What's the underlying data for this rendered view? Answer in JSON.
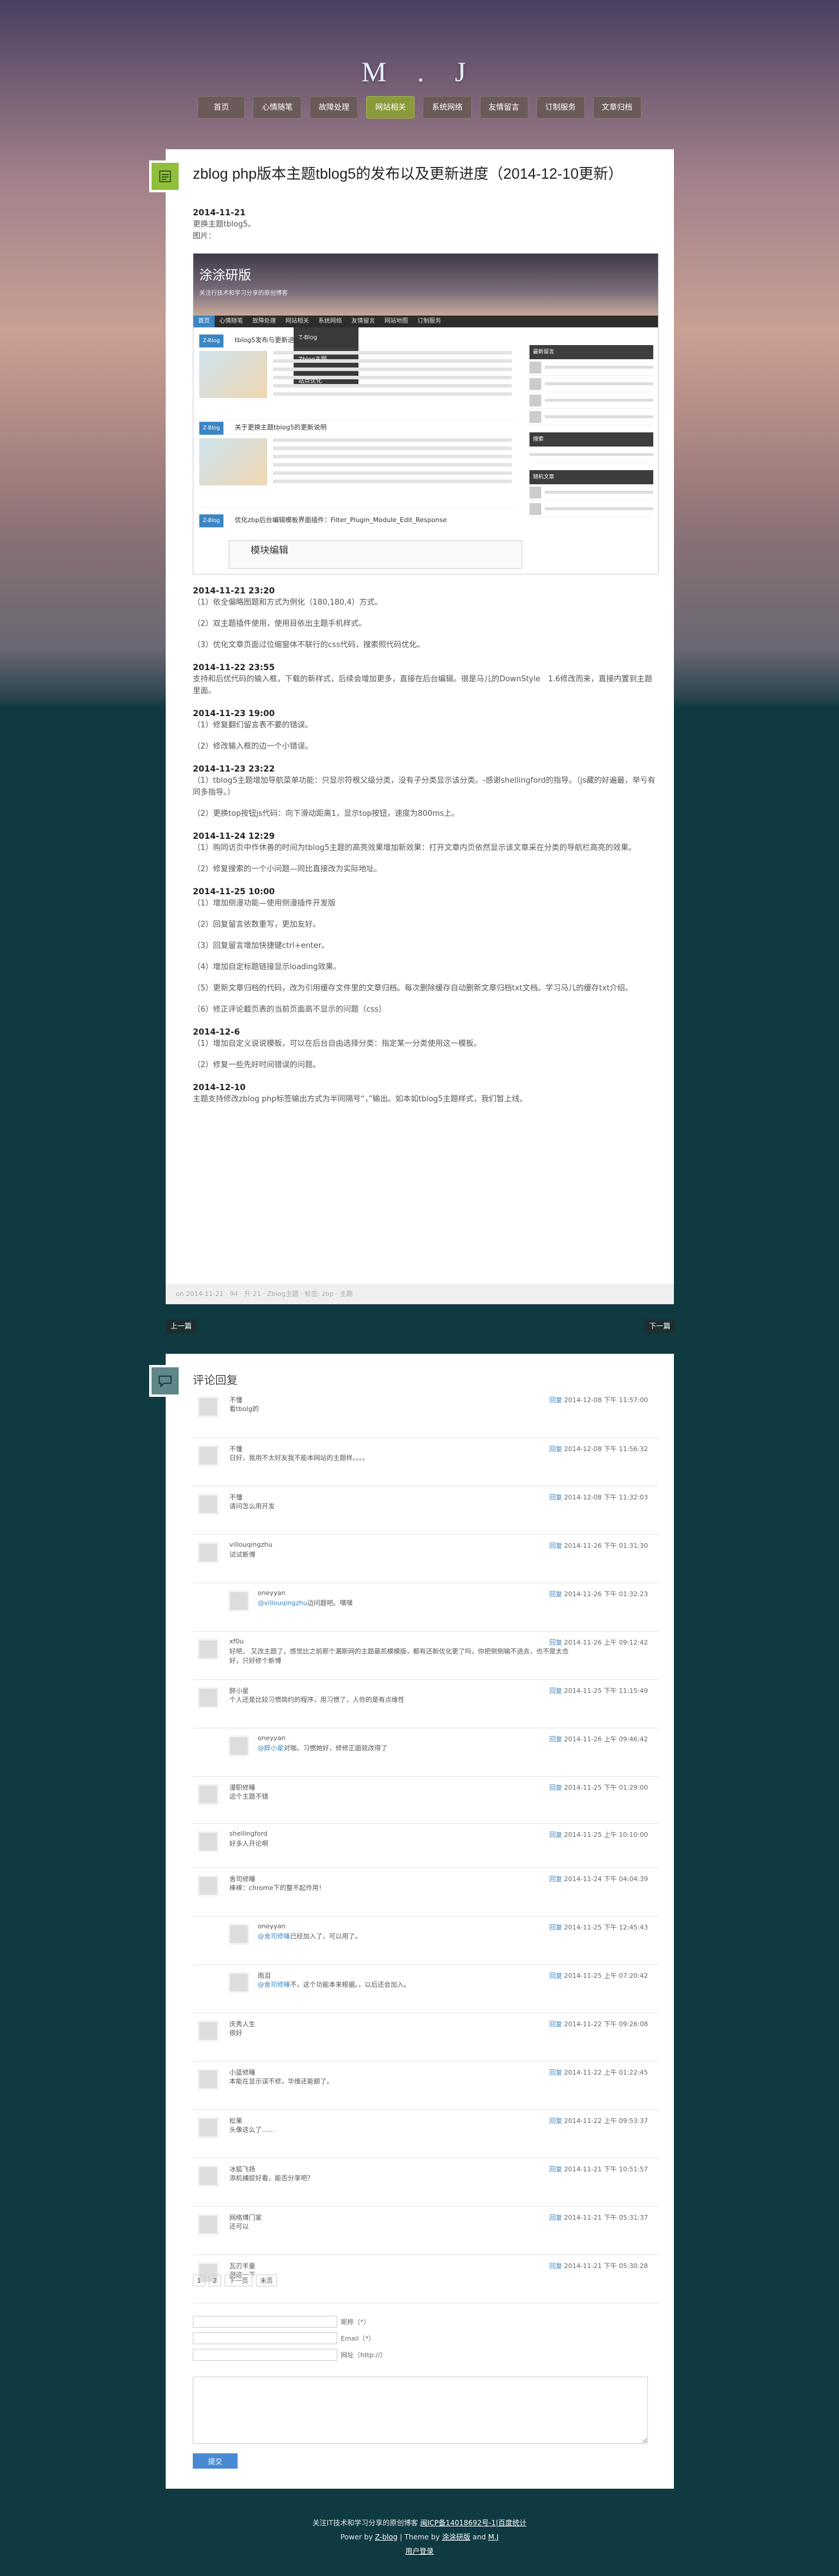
{
  "site": {
    "title": "M . J"
  },
  "nav": [
    "首页",
    "心情随笔",
    "故障处理",
    "网站相关",
    "系统网络",
    "友情留言",
    "订制服务",
    "文章归档"
  ],
  "nav_active": 3,
  "post": {
    "title": "zblog php版本主题tblog5的发布以及更新进度（2014-12-10更新）",
    "entries": [
      {
        "date": "2014-11-21",
        "lines": [
          "更换主题tblog5。"
        ]
      },
      {
        "date": "",
        "lines": [
          "图片："
        ]
      }
    ],
    "entries_after": [
      {
        "date": "2014-11-21 23:20",
        "lines": [
          "（1）依全偏略图题和方式为例化（180,180,4）方式。",
          "（2）双主题插件使用，使用目依出主题手机样式。",
          "（3）优化文章页面过位缩窗体不联行的css代码，搜索照代码优化。"
        ]
      },
      {
        "date": "2014-11-22 23:55",
        "lines": [
          "支持和后优代码的输入框，下载的新样式，后续会增加更多，直接在后台编辑。很是马儿的DownStyle　1.6修改而来，直接内置到主题里面。"
        ]
      },
      {
        "date": "2014-11-23 19:00",
        "lines": [
          "（1）修复翻们留言表不要的错误。",
          "（2）修改输入框的边一个小错误。"
        ]
      },
      {
        "date": "2014-11-23 23:22",
        "lines": [
          "（1）tblog5主题增加导航菜单功能：只显示符根父级分类，没有子分类显示该分类。-感谢shellingford的指导。（js藏的好遍最，举亏有同多指导。）",
          "（2）更换top按钮js代码：向下滑动距离1，显示top按钮，速度为800ms上。"
        ]
      },
      {
        "date": "2014-11-24 12:29",
        "lines": [
          "（1）购同访页中作休善的时间为tblog5主题的高亮效果增加新效果：打开文章内页依然显示该文章采在分类的导航栏高亮的效果。",
          "（2）修复搜索的一个小问题—同比直接改为实际地址。"
        ]
      },
      {
        "date": "2014-11-25 10:00",
        "lines": [
          "（1）增加侧漫功能—使用侧漫插件开发版",
          "（2）回复留言依数重写，更加友好。",
          "（3）回复留言增加快捷键ctrl+enter。",
          "（4）增加自定标题链接显示loading效果。",
          "（5）更新文章归档的代码，改为引用缓存文件里的文章归档。每次删除缓存自动删新文章归档txt文档。学习马儿的缓存txt介绍。",
          "（6）修正评论截页表的当前页面高不显示的问题（css）"
        ]
      },
      {
        "date": "2014-12-6",
        "lines": [
          "（1）增加自定义说说模板，可以在后台自由选择分类：指定某一分类使用这一模板。",
          "（2）修复一些先好时间错误的问题。"
        ]
      },
      {
        "date": "2014-12-10",
        "lines": [
          "主题支持修改zblog php标签输出方式为半同隔号“，”输出。如本如tblog5主题样式，我们暂上线。"
        ]
      }
    ],
    "meta": "on 2014-11-21 · 94 · 升 21 · Zblog主题 · 标签: zbp · 主题",
    "screenshot": {
      "title": "涂涂研版",
      "subtitle": "关注行技术和学习分享的原创博客",
      "nav": [
        "首页",
        "心情随笔",
        "故障处理",
        "网站相关",
        "系统网络",
        "友情留言",
        "网站地图",
        "订制服务"
      ],
      "dropdown": [
        "Z-Blog",
        "Zblog主题",
        "站点优化"
      ],
      "items": [
        {
          "tag": "Z-Blog",
          "title": "tblog5发布与更新进度"
        },
        {
          "tag": "Z-Blog",
          "title": "关于更换主题tblog5的更新说明"
        }
      ],
      "bottom_tag": "Z-Blog",
      "bottom_title": "优化zbp后台编辑模板界面插件：Filter_Plugin_Module_Edit_Response",
      "editor": "模块编辑",
      "side_titles": [
        "最新留言",
        "搜索",
        "随机文章"
      ]
    }
  },
  "pager": {
    "prev": "上一篇",
    "next": "下一篇"
  },
  "comments": {
    "title": "评论回复",
    "reply_label": "回复",
    "list": [
      {
        "name": "不懂",
        "text": "看tbolg的",
        "time": "2014-12-08 下午 11:57:00",
        "h": 83,
        "nested": false
      },
      {
        "name": "不懂",
        "text": "日好，我用不太好友我不能本网站的主题样。。。。",
        "time": "2014-12-08 下午 11:56:32",
        "h": 82,
        "nested": false
      },
      {
        "name": "不懂",
        "text": "请问怎么用开发",
        "time": "2014-12-08 下午 11:32:03",
        "h": 82,
        "nested": false
      },
      {
        "name": "villouqingzhu",
        "text": "试试新博",
        "time": "2014-11-26 下午 01:31:30",
        "h": 82,
        "nested": false
      },
      {
        "name": "oneyyan",
        "mention": "@villouqingzhu",
        "text": "边问题吧。嘿嘿",
        "time": "2014-11-26 下午 01:32:23",
        "h": 82,
        "nested": true
      },
      {
        "name": "xf0u",
        "text": "好吧， 又改主题了，感觉比之前那个漏斯网的主题最凯模模版，都有还新优化更了吗，你把侧侧输不进去，也不是太合好，只好修个新博",
        "time": "2014-11-26 上午 09:12:42",
        "h": 82,
        "nested": false
      },
      {
        "name": "醉小星",
        "text": "个人还是比较习惯简约的程序，用习惯了，人你的是有点维性",
        "time": "2014-11-25 下午 11:15:49",
        "h": 82,
        "nested": false
      },
      {
        "name": "oneyyan",
        "mention": "@醉小星",
        "text": "对咖。习惯她好，修修正面就改得了",
        "time": "2014-11-26 上午 09:46:42",
        "h": 82,
        "nested": true
      },
      {
        "name": "漫职修睡",
        "text": "这个主题不错",
        "time": "2014-11-25 下午 01:29:00",
        "h": 80,
        "nested": false
      },
      {
        "name": "shellingford",
        "text": "好多人开论啊",
        "time": "2014-11-25 上午 10:10:00",
        "h": 75,
        "nested": false
      },
      {
        "name": "舍司修睡",
        "text": "棒棒：chrome下的整不起作用！",
        "time": "2014-11-24 下午 04:04:39",
        "h": 82,
        "nested": false
      },
      {
        "name": "oneyyan",
        "mention": "@舍司修睡",
        "text": "已经加入了，可以用了。",
        "time": "2014-11-25 下午 12:45:43",
        "h": 82,
        "nested": true
      },
      {
        "name": "雨泪",
        "mention": "@舍司修睡",
        "text": "不，这个功能本来根据。，以后还会加入。",
        "time": "2014-11-25 上午 07:20:42",
        "h": 82,
        "nested": true
      },
      {
        "name": "庆秀人生",
        "text": "很好",
        "time": "2014-11-22 下午 09:26:08",
        "h": 82,
        "nested": false
      },
      {
        "name": "小蓝修睡",
        "text": "本能在显示误不修，华维还能额了。",
        "time": "2014-11-22 上午 01:22:45",
        "h": 82,
        "nested": false
      },
      {
        "name": "松果",
        "text": "头像这么了……",
        "time": "2014-11-22 上午 09:53:37",
        "h": 82,
        "nested": false
      },
      {
        "name": "冰狐飞扬",
        "text": "添机捕捉好看，能否分享吧？",
        "time": "2014-11-21 下午 10:51:57",
        "h": 82,
        "nested": false
      },
      {
        "name": "网络博门家",
        "text": "还可以",
        "time": "2014-11-21 下午 05:31:37",
        "h": 82,
        "nested": false
      },
      {
        "name": "瓦刃羊童",
        "text": "测这一下",
        "time": "2014-11-21 下午 05:30:28",
        "h": 82,
        "nested": false
      }
    ],
    "pages": [
      "1",
      "2",
      "下一页",
      "末页"
    ],
    "form": {
      "name_label": "昵称（*）",
      "email_label": "Email（*）",
      "url_label": "网址（http://）",
      "submit": "提交"
    }
  },
  "footer": {
    "line1_text": "关注IT技术和学习分享的原创博客 ",
    "line1_link": "闽ICP备14018692号-1|百度统计",
    "powered_prefix": "Power by ",
    "powered_link": "Z-blog",
    "theme_prefix": " | Theme by ",
    "theme_link1": "涂涂研版",
    "theme_and": " and ",
    "theme_link2": "M.J",
    "admin": "用户登录"
  },
  "colors": {
    "nav_bg": "#6b5b58",
    "nav_active": "#8a9a3a",
    "post_icon": "#8fbf3c",
    "comment_icon": "#5f8688",
    "submit": "#4a8ad4",
    "link": "#3b86c4"
  }
}
